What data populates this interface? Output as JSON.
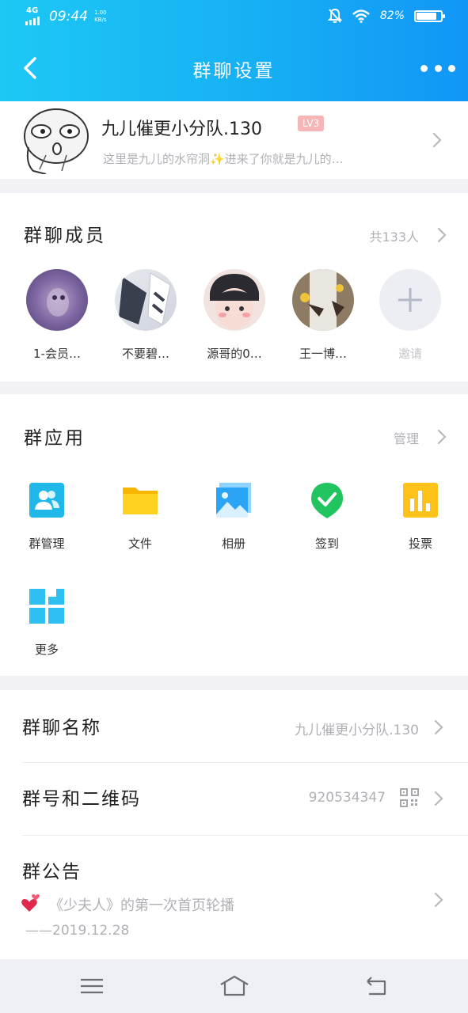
{
  "status_bar": {
    "network": "4G",
    "time": "09:44",
    "speed_value": "1.00",
    "speed_unit": "KB/s",
    "battery": "82%",
    "battery_level": 0.82
  },
  "nav": {
    "title": "群聊设置"
  },
  "group": {
    "name": "九儿催更小分队.130",
    "level": "LV3",
    "description": "这里是九儿的水帘洞✨进来了你就是九儿的…"
  },
  "members": {
    "title": "群聊成员",
    "count": "共133人",
    "list": [
      {
        "name": "1-会员…"
      },
      {
        "name": "不要碧…"
      },
      {
        "name": "源哥的0…"
      },
      {
        "name": "王一博…"
      }
    ],
    "invite_label": "邀请"
  },
  "apps": {
    "title": "群应用",
    "manage": "管理",
    "items": [
      {
        "label": "群管理",
        "icon": "group-manage-icon"
      },
      {
        "label": "文件",
        "icon": "folder-icon"
      },
      {
        "label": "相册",
        "icon": "album-icon"
      },
      {
        "label": "签到",
        "icon": "check-in-icon"
      },
      {
        "label": "投票",
        "icon": "vote-icon"
      },
      {
        "label": "更多",
        "icon": "more-grid-icon"
      }
    ]
  },
  "settings": {
    "group_name_label": "群聊名称",
    "group_name_value": "九儿催更小分队.130",
    "group_number_label": "群号和二维码",
    "group_number_value": "920534347",
    "notice_label": "群公告",
    "notice_text": "《少夫人》的第一次首页轮播",
    "notice_date": "——2019.12.28"
  },
  "colors": {
    "header_start": "#1dc8f5",
    "header_end": "#1296f6",
    "level_badge": "#f4b6b6"
  }
}
